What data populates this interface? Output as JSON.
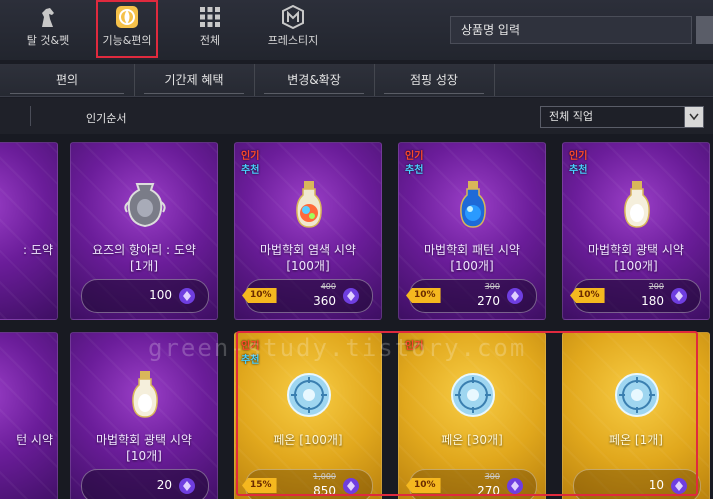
{
  "topnav": [
    {
      "label": "탈 것&펫",
      "icon": "horse-icon",
      "active": false
    },
    {
      "label": "기능&편의",
      "icon": "swirl-icon",
      "active": true
    },
    {
      "label": "전체",
      "icon": "grid-icon",
      "active": false
    },
    {
      "label": "프레스티지",
      "icon": "m-emblem-icon",
      "active": false
    }
  ],
  "search": {
    "placeholder": "상품명 입력"
  },
  "subtabs": [
    "편의",
    "기간제 혜택",
    "변경&확장",
    "점핑 성장"
  ],
  "filter": {
    "sort_label": "인기순서",
    "job_select": "전체 직업"
  },
  "cards": [
    {
      "name": ": 도약",
      "qty": "",
      "price": "",
      "old_price": "",
      "discount": "",
      "hot": false,
      "rec": false,
      "theme": "purple",
      "art": "potion-cyan"
    },
    {
      "name": "요즈의 항아리 : 도약",
      "qty": "[1개]",
      "price": "100",
      "old_price": "",
      "discount": "",
      "hot": false,
      "rec": false,
      "theme": "purple",
      "art": "urn"
    },
    {
      "name": "마법학회 염색 시약",
      "qty": "[100개]",
      "price": "360",
      "old_price": "400",
      "discount": "10%",
      "hot": true,
      "rec": true,
      "theme": "purple",
      "art": "potion-rainbow"
    },
    {
      "name": "마법학회 패턴 시약",
      "qty": "[100개]",
      "price": "270",
      "old_price": "300",
      "discount": "10%",
      "hot": true,
      "rec": true,
      "theme": "purple",
      "art": "potion-blue"
    },
    {
      "name": "마법학회 광택 시약",
      "qty": "[100개]",
      "price": "180",
      "old_price": "200",
      "discount": "10%",
      "hot": true,
      "rec": true,
      "theme": "purple",
      "art": "potion-white"
    },
    {
      "name": "턴 시약",
      "qty": "",
      "price": "",
      "old_price": "",
      "discount": "",
      "hot": false,
      "rec": false,
      "theme": "purple",
      "art": "potion-white"
    },
    {
      "name": "마법학회 광택 시약",
      "qty": "[10개]",
      "price": "20",
      "old_price": "",
      "discount": "",
      "hot": false,
      "rec": false,
      "theme": "purple",
      "art": "potion-white"
    },
    {
      "name": "페온 [100개]",
      "qty": "",
      "price": "850",
      "old_price": "1,000",
      "discount": "15%",
      "hot": true,
      "rec": true,
      "theme": "gold",
      "art": "peon"
    },
    {
      "name": "페온 [30개]",
      "qty": "",
      "price": "270",
      "old_price": "300",
      "discount": "10%",
      "hot": true,
      "rec": false,
      "theme": "gold",
      "art": "peon"
    },
    {
      "name": "페온 [1개]",
      "qty": "",
      "price": "10",
      "old_price": "",
      "discount": "",
      "hot": false,
      "rec": false,
      "theme": "gold",
      "art": "peon"
    }
  ],
  "labels": {
    "hot": "인기",
    "rec": "추천"
  },
  "watermark": "green-study.tistory.com",
  "colors": {
    "highlight": "#e02a3e",
    "purple_card": "#6b1d9a",
    "gold_card": "#e1a81d",
    "hot": "#ff4a2a",
    "rec": "#4ad0ff"
  }
}
